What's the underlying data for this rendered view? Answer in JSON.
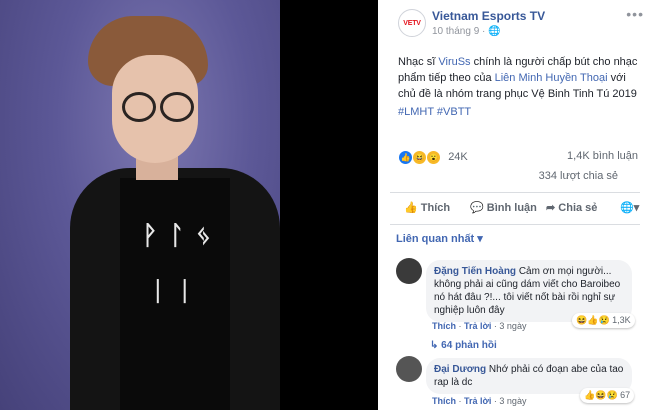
{
  "page": {
    "name": "Vietnam Esports TV",
    "logo_text": "VETV",
    "date": "10 tháng 9",
    "privacy_icon": "globe-icon",
    "more_icon": "more-horizontal-icon"
  },
  "post": {
    "prefix": "Nhạc sĩ ",
    "link1": "ViruSs",
    "mid1": " chính là người chấp bút cho nhạc phẩm tiếp theo của ",
    "link2": "Liên Minh Huyền Thoại",
    "suffix": " với chủ đề là nhóm trang phục Vệ Binh Tinh Tú 2019",
    "tags": "#LMHT #VBTT"
  },
  "stats": {
    "reactions": "24K",
    "comments": "1,4K bình luận",
    "shares": "334 lượt chia sẻ"
  },
  "actions": {
    "like": "Thích",
    "comment": "Bình luận",
    "share": "Chia sẻ"
  },
  "sort_label": "Liên quan nhất",
  "comments": [
    {
      "name": "Đặng Tiến Hoàng",
      "text": "Cảm ơn mọi người... không phải ai cũng dám viết cho Baroibeo nó hát đâu ?!... tôi viết nốt bài rồi nghỉ sự nghiệp luôn đây",
      "like": "Thích",
      "reply": "Trả lời",
      "time": "3 ngày",
      "reactions": "1,3K",
      "replies": "64 phản hồi"
    },
    {
      "name": "Đại Dương",
      "text": "Nhớ phải có đoạn abe của tao rap là dc",
      "like": "Thích",
      "reply": "Trả lời",
      "time": "3 ngày",
      "reactions": "67"
    }
  ],
  "colors": {
    "brand": "#4267b2",
    "name": "#385898",
    "logo_red": "#e4151f"
  }
}
